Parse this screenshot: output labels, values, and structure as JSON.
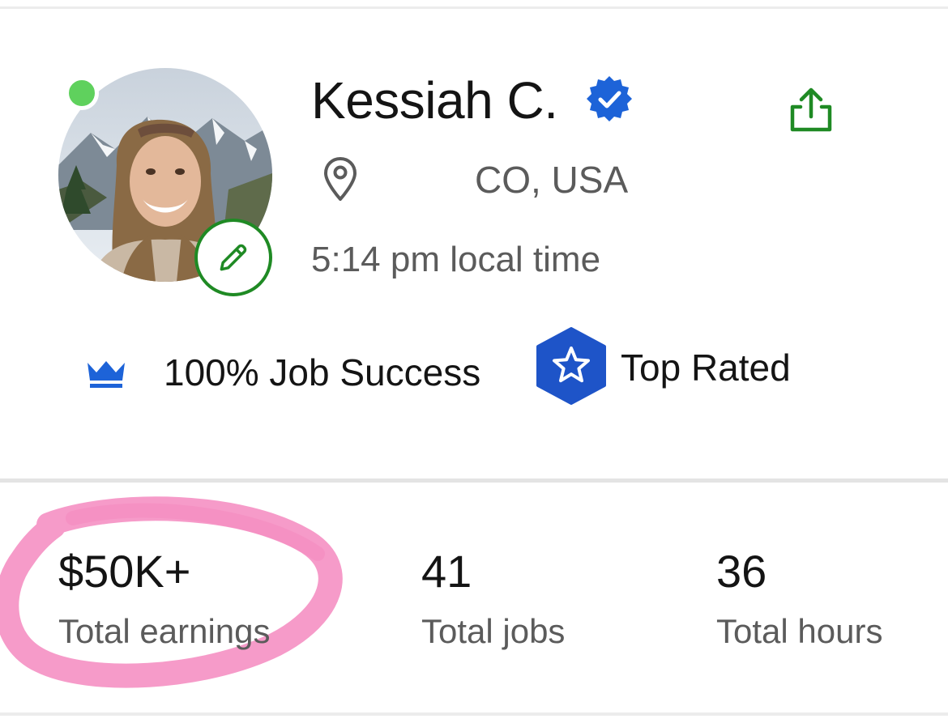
{
  "profile": {
    "name": "Kessiah C.",
    "location": "CO, USA",
    "local_time": "5:14 pm local time",
    "online": true,
    "verified": true
  },
  "badges": {
    "job_success": "100% Job Success",
    "top_rated": "Top Rated"
  },
  "stats": [
    {
      "value": "$50K+",
      "label": "Total earnings",
      "highlighted": true
    },
    {
      "value": "41",
      "label": "Total jobs"
    },
    {
      "value": "36",
      "label": "Total hours"
    }
  ],
  "icons": {
    "online": "online-status-dot",
    "verified": "verified-badge-icon",
    "share": "share-icon",
    "location": "map-pin-icon",
    "edit": "pencil-icon",
    "job_success": "crown-icon",
    "top_rated": "star-badge-icon"
  },
  "colors": {
    "brand_green": "#1f8a24",
    "online_green": "#5fd15d",
    "verified_blue": "#1d63d8",
    "top_rated_blue": "#1e54c8",
    "highlight_pink": "#f58ac0"
  }
}
